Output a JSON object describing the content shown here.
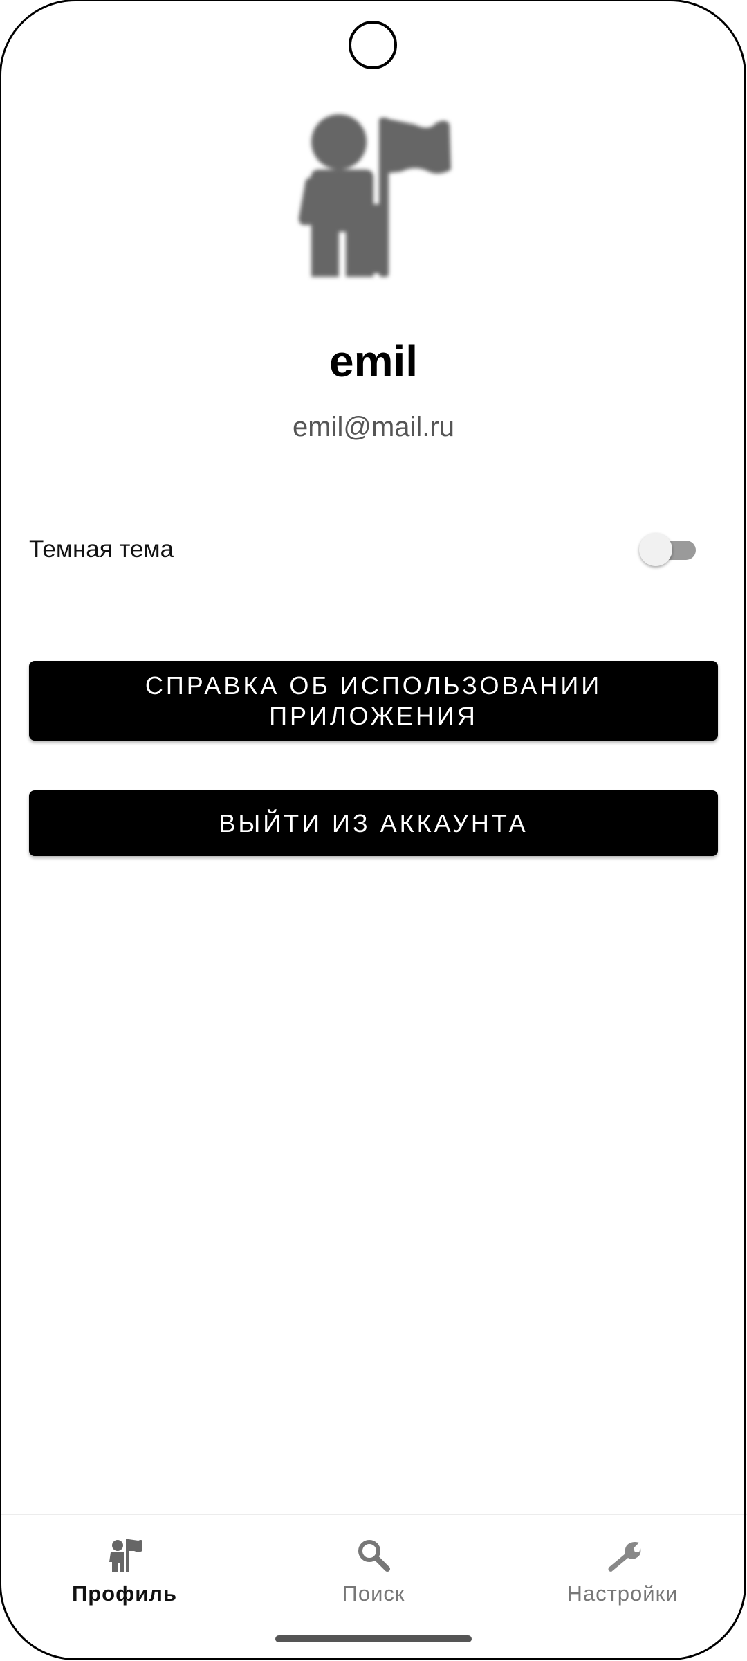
{
  "profile": {
    "username": "emil",
    "email": "emil@mail.ru",
    "avatar_icon": "person-with-flag-icon"
  },
  "settings": {
    "dark_theme_label": "Темная тема",
    "dark_theme_enabled": false
  },
  "buttons": {
    "help_label": "СПРАВКА ОБ ИСПОЛЬЗОВАНИИ ПРИЛОЖЕНИЯ",
    "logout_label": "ВЫЙТИ ИЗ АККАУНТА"
  },
  "nav": {
    "items": [
      {
        "label": "Профиль",
        "icon": "person-with-flag-icon",
        "active": true
      },
      {
        "label": "Поиск",
        "icon": "search-icon",
        "active": false
      },
      {
        "label": "Настройки",
        "icon": "wrench-icon",
        "active": false
      }
    ]
  },
  "colors": {
    "button_bg": "#000000",
    "button_text": "#ffffff",
    "active_nav": "#111111",
    "inactive_nav": "#777777",
    "icon_gray": "#666666"
  }
}
